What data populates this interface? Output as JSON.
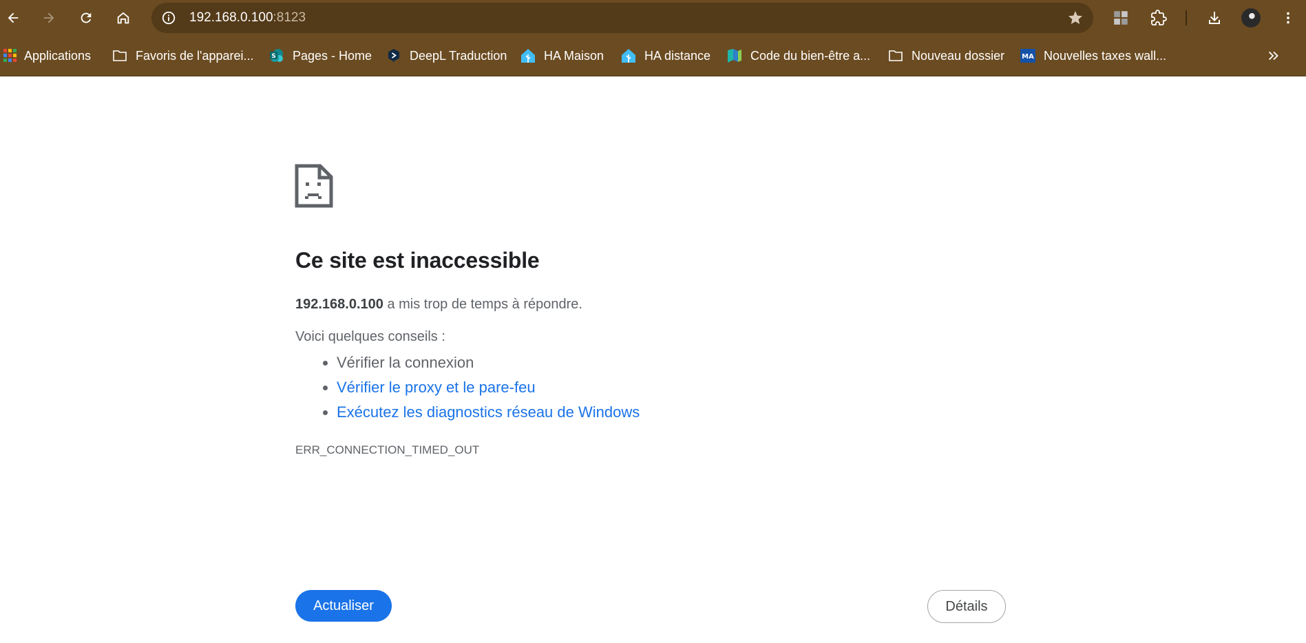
{
  "browser": {
    "address_host": "192.168.0.100",
    "address_port": ":8123",
    "toolbar_color": "#6b4b21"
  },
  "bookmarks": [
    {
      "label": "Applications",
      "icon": "apps-grid-icon"
    },
    {
      "label": "Favoris de l'apparei...",
      "icon": "folder-icon"
    },
    {
      "label": "Pages - Home",
      "icon": "sharepoint-icon"
    },
    {
      "label": "DeepL Traduction",
      "icon": "deepl-icon"
    },
    {
      "label": "HA Maison",
      "icon": "home-assistant-icon"
    },
    {
      "label": "HA distance",
      "icon": "home-assistant-icon"
    },
    {
      "label": "Code du bien-être a...",
      "icon": "site-favicon-icon"
    },
    {
      "label": "Nouveau dossier",
      "icon": "folder-icon"
    },
    {
      "label": "Nouvelles taxes wall...",
      "icon": "ma-favicon-icon"
    }
  ],
  "error_page": {
    "title": "Ce site est inaccessible",
    "host": "192.168.0.100",
    "description": " a mis trop de temps à répondre.",
    "tips_label": "Voici quelques conseils :",
    "tips": [
      {
        "text": "Vérifier la connexion",
        "is_link": false
      },
      {
        "text": "Vérifier le proxy et le pare-feu",
        "is_link": true
      },
      {
        "text": "Exécutez les diagnostics réseau de Windows",
        "is_link": true
      }
    ],
    "error_code": "ERR_CONNECTION_TIMED_OUT",
    "reload_label": "Actualiser",
    "details_label": "Détails",
    "accent_color": "#1a73e8"
  }
}
